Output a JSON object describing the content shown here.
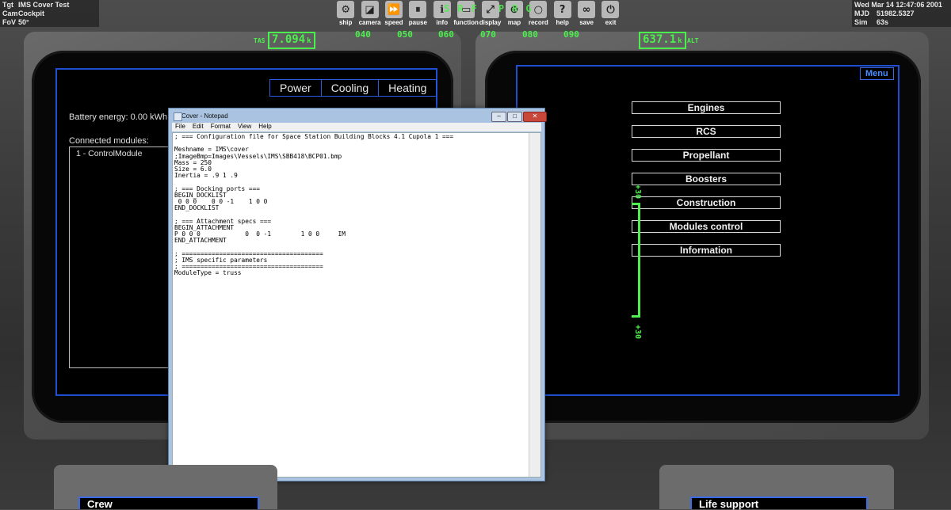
{
  "hud_left": {
    "rows": [
      {
        "label": "Tgt",
        "value": "IMS Cover Test"
      },
      {
        "label": "Cam",
        "value": "Cockpit"
      },
      {
        "label": "FoV",
        "value": "50°"
      }
    ]
  },
  "hud_right": {
    "date": "Wed Mar 14 12:47:06 2001",
    "rows": [
      {
        "label": "MJD",
        "value": "51982.5327"
      },
      {
        "label": "Sim",
        "value": "63s"
      }
    ]
  },
  "toolbar": [
    {
      "label": "ship",
      "icon": "ship-icon",
      "glyph": "⚙"
    },
    {
      "label": "camera",
      "icon": "camera-icon",
      "glyph": "◪"
    },
    {
      "label": "speed",
      "icon": "fast-forward-icon",
      "glyph": "⏩"
    },
    {
      "label": "pause",
      "icon": "pause-icon",
      "glyph": "⏸"
    },
    {
      "label": "info",
      "icon": "info-icon",
      "glyph": "ℹ"
    },
    {
      "label": "function",
      "icon": "function-icon",
      "glyph": "▭"
    },
    {
      "label": "display",
      "icon": "display-icon",
      "glyph": "⤢"
    },
    {
      "label": "map",
      "icon": "globe-icon",
      "glyph": "⊕"
    },
    {
      "label": "record",
      "icon": "record-icon",
      "glyph": "○"
    },
    {
      "label": "help",
      "icon": "help-icon",
      "glyph": "?"
    },
    {
      "label": "save",
      "icon": "save-icon",
      "glyph": "∞"
    },
    {
      "label": "exit",
      "icon": "power-icon",
      "glyph": "⏻"
    }
  ],
  "hud": {
    "heading_ticks": [
      "040",
      "050",
      "060",
      "070",
      "080",
      "090"
    ],
    "heading_overlay": "SRF PRG",
    "tas_label": "TAS",
    "tas_value": "7.094",
    "tas_unit": "k",
    "alt_value": "637.1",
    "alt_unit": "k",
    "alt_label": "ALT",
    "pitch_top": "+30",
    "pitch_bottom": "+30",
    "color": "#4cf04c"
  },
  "left_mfd": {
    "tabs": [
      "Power",
      "Cooling",
      "Heating"
    ],
    "battery": "Battery energy: 0.00 kWh",
    "connected_label": "Connected modules:",
    "modules": [
      "1 - ControlModule"
    ]
  },
  "right_mfd": {
    "menu_label": "Menu",
    "buttons": [
      "Engines",
      "RCS",
      "Propellant",
      "Boosters",
      "Construction",
      "Modules control",
      "Information"
    ]
  },
  "notepad": {
    "title": "Cover - Notepad",
    "menu": [
      "File",
      "Edit",
      "Format",
      "View",
      "Help"
    ],
    "content": "; === Configuration file for Space Station Building Blocks 4.1 Cupola 1 ===\n\nMeshname = IMS\\cover\n;ImageBmp=Images\\Vessels\\IMS\\SBB418\\BCP01.bmp\nMass = 250\nSize = 6.0\nInertia = .9 1 .9\n\n; === Docking ports ===\nBEGIN_DOCKLIST\n 0 0 0    0 0 -1    1 0 0\nEND_DOCKLIST\n\n; === Attachment specs ===\nBEGIN_ATTACHMENT\nP 0 0 0            0  0 -1        1 0 0     IM\nEND_ATTACHMENT\n\n; ======================================\n; IMS specific parameters\n; ======================================\nModuleType = truss"
  },
  "bottom": {
    "left_title": "Crew",
    "right_title": "Life support"
  },
  "colors": {
    "screen_border": "#1d4fd0",
    "menu_blue": "#4a8cff"
  }
}
